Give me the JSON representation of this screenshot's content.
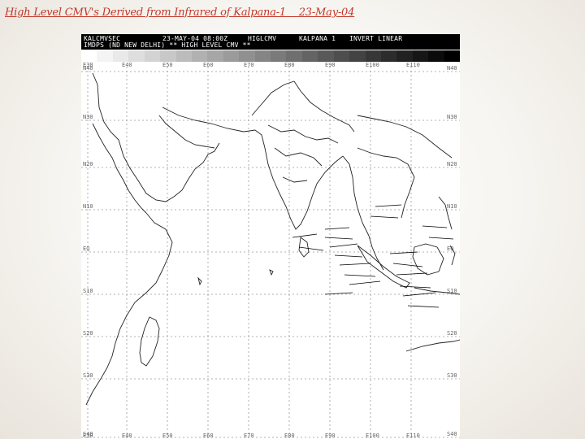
{
  "slide": {
    "title": "High Level CMV's Derived from Infrared of Kalpana-1    23-May-04"
  },
  "satellite_header": {
    "line1_left": "KALCMVSEC",
    "line1_date": "23-MAY-04 08:00Z",
    "line1_product": "HIGLCMV",
    "line1_sat": "KALPANA 1",
    "line1_mode": "INVERT LINEAR",
    "line2": "IMDPS (ND NEW DELHI) ** HIGH LEVEL CMV **"
  },
  "grid": {
    "lon_labels": [
      "E30",
      "E40",
      "E50",
      "E60",
      "E70",
      "E80",
      "E90",
      "E100",
      "E110"
    ],
    "lat_labels_left": [
      "N40",
      "N30",
      "N20",
      "N10",
      "EQ",
      "S10",
      "S20",
      "S30",
      "S40"
    ],
    "lat_labels_right": [
      "N40",
      "N30",
      "N20",
      "N10",
      "EQ",
      "S10",
      "S20",
      "S30",
      "S40"
    ]
  },
  "colors": {
    "title": "#c0392b",
    "header_bg": "#000000",
    "coast": "#222222",
    "grid": "#999999"
  }
}
